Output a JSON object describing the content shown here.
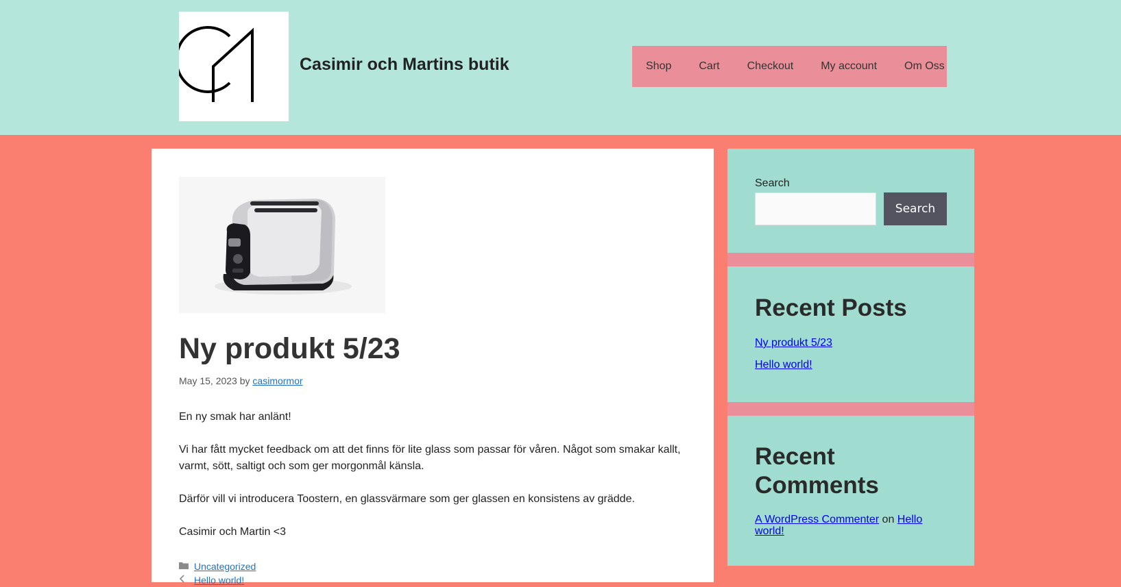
{
  "header": {
    "site_title": "Casimir och Martins butik",
    "nav": [
      "Shop",
      "Cart",
      "Checkout",
      "My account",
      "Om Oss"
    ]
  },
  "post": {
    "title": "Ny produkt 5/23",
    "date": "May 15, 2023",
    "by": "by",
    "author": "casimormor",
    "paragraphs": [
      "En ny smak har anlänt!",
      "Vi har fått mycket feedback om att det finns för lite glass som passar för våren. Något som smakar kallt, varmt, sött, saltigt och som ger morgonmål känsla.",
      "Därför vill vi introducera Toostern, en glassvärmare som ger glassen en konsistens av grädde.",
      "Casimir och Martin <3"
    ],
    "category": "Uncategorized",
    "prev_post": "Hello world!"
  },
  "sidebar": {
    "search_label": "Search",
    "search_button": "Search",
    "recent_posts_title": "Recent Posts",
    "recent_posts": [
      "Ny produkt 5/23",
      "Hello world!"
    ],
    "recent_comments_title": "Recent Comments",
    "comment_author": "A WordPress Commenter",
    "comment_on": "on",
    "comment_post": "Hello world!"
  },
  "colors": {
    "header_bg": "#b4e6dc",
    "page_bg": "#fa7f70",
    "nav_bg": "#ea8f99",
    "sidebar_bg": "#a0ddd0",
    "button_bg": "#545461",
    "link": "#1e73be"
  }
}
